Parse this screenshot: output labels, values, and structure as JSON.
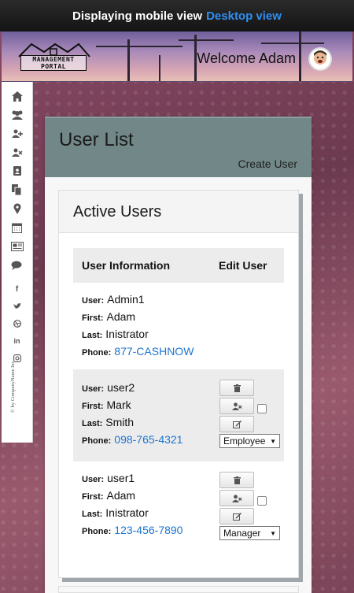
{
  "banner": {
    "text": "Displaying mobile view",
    "link": "Desktop view"
  },
  "header": {
    "logo_text_1": "MANAGEMENT",
    "logo_text_2": "PORTAL",
    "welcome": "Welcome Adam"
  },
  "sidebar": {
    "icons": [
      "home-icon",
      "users-icon",
      "add-user-icon",
      "remove-user-icon",
      "address-book-icon",
      "copy-icon",
      "map-marker-icon",
      "calendar-icon",
      "newspaper-icon",
      "chat-icon",
      "facebook-icon",
      "twitter-icon",
      "dribbble-icon",
      "linkedin-icon",
      "instagram-icon"
    ],
    "credit": "© by CompanyName Inc"
  },
  "panel": {
    "title": "User List",
    "create_link": "Create User",
    "card_title": "Active Users",
    "col_info": "User Information",
    "col_edit": "Edit User",
    "labels": {
      "user": "User:",
      "first": "First:",
      "last": "Last:",
      "phone": "Phone:"
    },
    "users": [
      {
        "user": "Admin1",
        "first": "Adam",
        "last": "Inistrator",
        "phone": "877-CASHNOW"
      },
      {
        "user": "user2",
        "first": "Mark",
        "last": "Smith",
        "phone": "098-765-4321",
        "role": "Employee"
      },
      {
        "user": "user1",
        "first": "Adam",
        "last": "Inistrator",
        "phone": "123-456-7890",
        "role": "Manager"
      }
    ]
  },
  "colors": {
    "accent": "#2f8ff0",
    "panel_header": "#728888",
    "phone_link": "#1a75d2"
  }
}
